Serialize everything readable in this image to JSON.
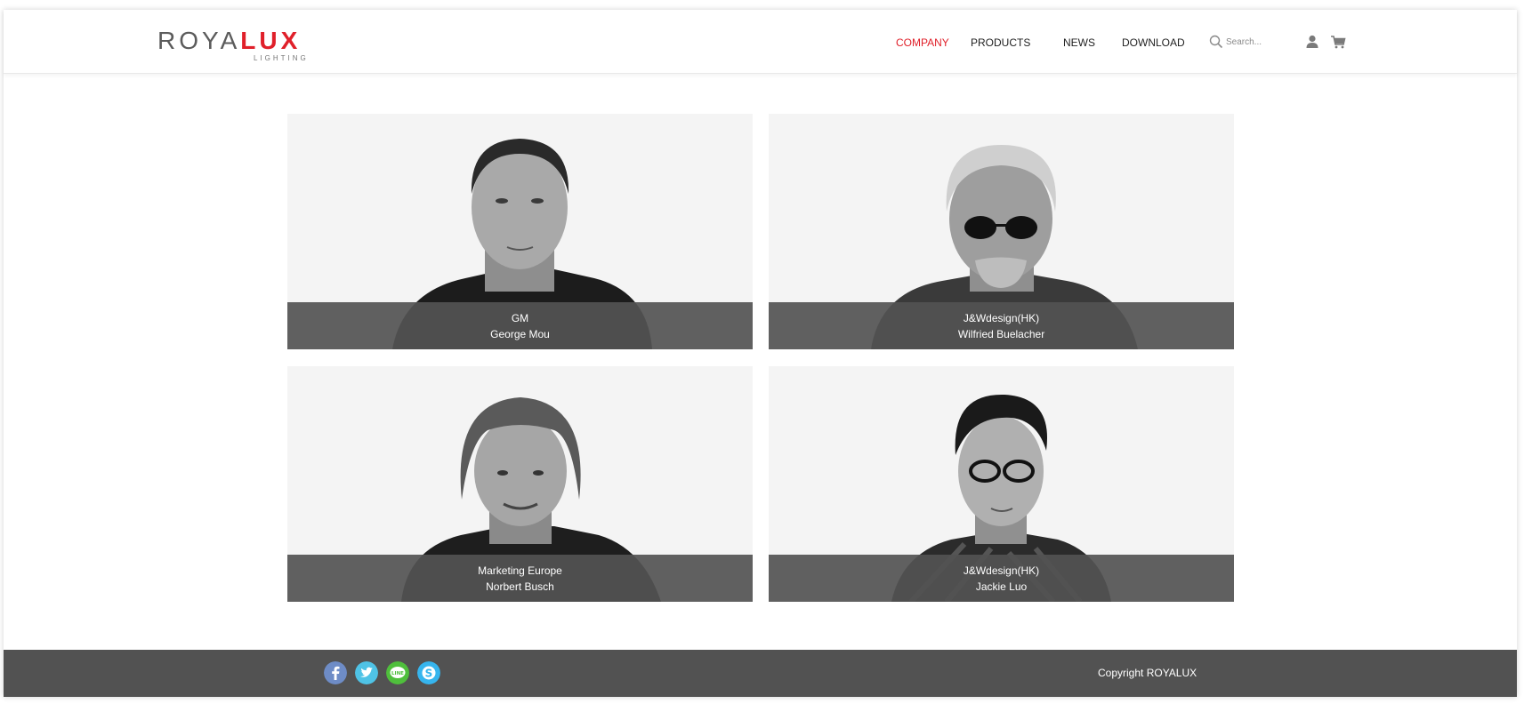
{
  "brand": {
    "logo_primary": "ROYA",
    "logo_accent": "LUX",
    "logo_sub": "LIGHTING",
    "accent_color": "#e0202a"
  },
  "nav": {
    "company": "COMPANY",
    "products": "PRODUCTS",
    "news": "NEWS",
    "download": "DOWNLOAD"
  },
  "search": {
    "placeholder": "Search..."
  },
  "icons": {
    "search": "search-icon",
    "user": "user-icon",
    "cart": "cart-icon"
  },
  "team": [
    {
      "role": "GM",
      "name": "George Mou"
    },
    {
      "role": "J&Wdesign(HK)",
      "name": "Wilfried Buelacher"
    },
    {
      "role": "Marketing Europe",
      "name": "Norbert Busch"
    },
    {
      "role": "J&Wdesign(HK)",
      "name": "Jackie Luo"
    }
  ],
  "footer": {
    "social": [
      "facebook-icon",
      "twitter-icon",
      "line-icon",
      "skype-icon"
    ],
    "copyright": "Copyright ROYALUX"
  }
}
